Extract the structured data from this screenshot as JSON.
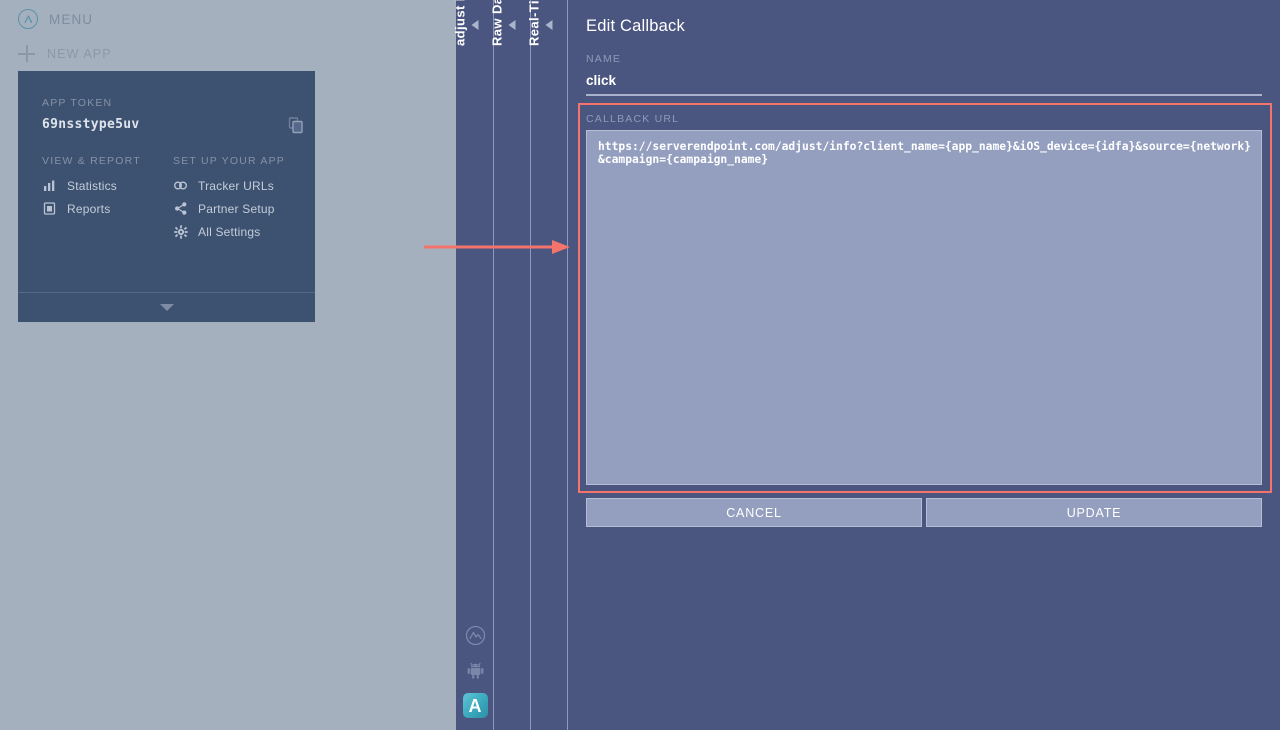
{
  "sidebar": {
    "menu_label": "MENU",
    "logo_icon": "adjust-logo-icon",
    "new_app_label": "NEW APP",
    "app_card": {
      "token_label": "APP TOKEN",
      "token_value": "69nsstype5uv",
      "copy_icon": "copy-icon",
      "view_report_label": "VIEW & REPORT",
      "setup_label": "SET UP YOUR APP",
      "view_report_items": [
        {
          "label": "Statistics",
          "icon": "bar-chart-icon"
        },
        {
          "label": "Reports",
          "icon": "report-document-icon"
        }
      ],
      "setup_items": [
        {
          "label": "Tracker URLs",
          "icon": "link-chain-icon"
        },
        {
          "label": "Partner Setup",
          "icon": "share-nodes-icon"
        },
        {
          "label": "All Settings",
          "icon": "gear-icon"
        }
      ],
      "expand_icon": "chevron-down-icon"
    }
  },
  "rail": {
    "tabs": [
      {
        "label": "adjust Demo App",
        "collapse_icon": "caret-left-icon"
      },
      {
        "label": "Raw Data Export",
        "collapse_icon": "caret-left-icon"
      },
      {
        "label": "Real-Time Callbacks",
        "collapse_icon": "caret-left-icon"
      }
    ],
    "icons": [
      {
        "name": "adjust-circle-icon"
      },
      {
        "name": "android-robot-icon"
      },
      {
        "name": "app-icon",
        "letter": "A"
      }
    ]
  },
  "panel": {
    "title": "Edit Callback",
    "name_label": "NAME",
    "name_value": "click",
    "url_label": "CALLBACK URL",
    "url_value": "https://serverendpoint.com/adjust/info?client_name={app_name}&iOS_device={idfa}&source={network}&campaign={campaign_name}",
    "cancel_label": "CANCEL",
    "update_label": "UPDATE"
  },
  "annotation": {
    "arrow_icon": "red-arrow-right-icon",
    "highlight_icon": "red-highlight-box"
  },
  "colors": {
    "page_bg": "#a4b0bd",
    "card_bg": "#3d5270",
    "panel_bg": "#4b5680",
    "field_bg": "#949fc0",
    "accent_teal": "#5b93a8",
    "annotation_red": "#f4736b"
  }
}
